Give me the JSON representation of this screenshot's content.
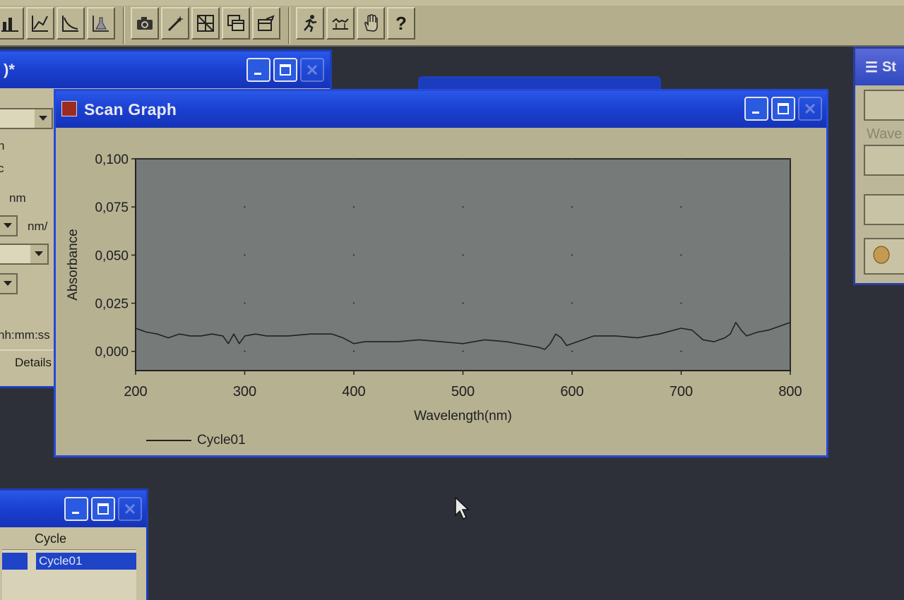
{
  "toolbar": {
    "icons": [
      "bar-chart-icon",
      "line-chart-icon",
      "curve-chart-icon",
      "flask-chart-icon",
      "camera-icon",
      "wand-icon",
      "grid-icon",
      "window-copy-icon",
      "export-icon",
      "runner-icon",
      "baseline-icon",
      "hand-icon",
      "help-icon"
    ],
    "help_label": "?"
  },
  "left_window": {
    "title": ")*",
    "labels": [
      "n",
      "c",
      "nm",
      "nm/",
      "hh:mm:ss"
    ],
    "details_tab": "Details"
  },
  "right_window": {
    "title": "St",
    "label": "Wave"
  },
  "bottom_window": {
    "column_header": "Cycle",
    "selected_item": "Cycle01"
  },
  "scan_window": {
    "title": "Scan Graph",
    "legend": "Cycle01"
  },
  "chart_data": {
    "type": "line",
    "title": "",
    "xlabel": "Wavelength(nm)",
    "ylabel": "Absorbance",
    "xlim": [
      200,
      800
    ],
    "ylim": [
      -0.01,
      0.1
    ],
    "xticks": [
      200,
      300,
      400,
      500,
      600,
      700,
      800
    ],
    "yticks": [
      0.0,
      0.025,
      0.05,
      0.075,
      0.1
    ],
    "ytick_labels": [
      "0,000",
      "0,025",
      "0,050",
      "0,075",
      "0,100"
    ],
    "grid": "dotted",
    "legend_position": "bottom-left",
    "series": [
      {
        "name": "Cycle01",
        "color": "#222222",
        "x": [
          200,
          210,
          220,
          230,
          240,
          250,
          260,
          270,
          280,
          285,
          290,
          295,
          300,
          310,
          320,
          340,
          360,
          380,
          390,
          400,
          410,
          420,
          440,
          460,
          480,
          500,
          510,
          520,
          540,
          560,
          570,
          575,
          580,
          585,
          590,
          595,
          600,
          610,
          620,
          640,
          660,
          680,
          700,
          710,
          720,
          730,
          740,
          745,
          750,
          755,
          760,
          770,
          780,
          790,
          800
        ],
        "y": [
          0.012,
          0.01,
          0.009,
          0.007,
          0.009,
          0.008,
          0.008,
          0.009,
          0.008,
          0.004,
          0.009,
          0.004,
          0.008,
          0.009,
          0.008,
          0.008,
          0.009,
          0.009,
          0.007,
          0.004,
          0.005,
          0.005,
          0.005,
          0.006,
          0.005,
          0.004,
          0.005,
          0.006,
          0.005,
          0.003,
          0.002,
          0.001,
          0.004,
          0.009,
          0.007,
          0.003,
          0.004,
          0.006,
          0.008,
          0.008,
          0.007,
          0.009,
          0.012,
          0.011,
          0.006,
          0.005,
          0.007,
          0.009,
          0.015,
          0.011,
          0.008,
          0.01,
          0.011,
          0.013,
          0.015
        ]
      }
    ]
  }
}
